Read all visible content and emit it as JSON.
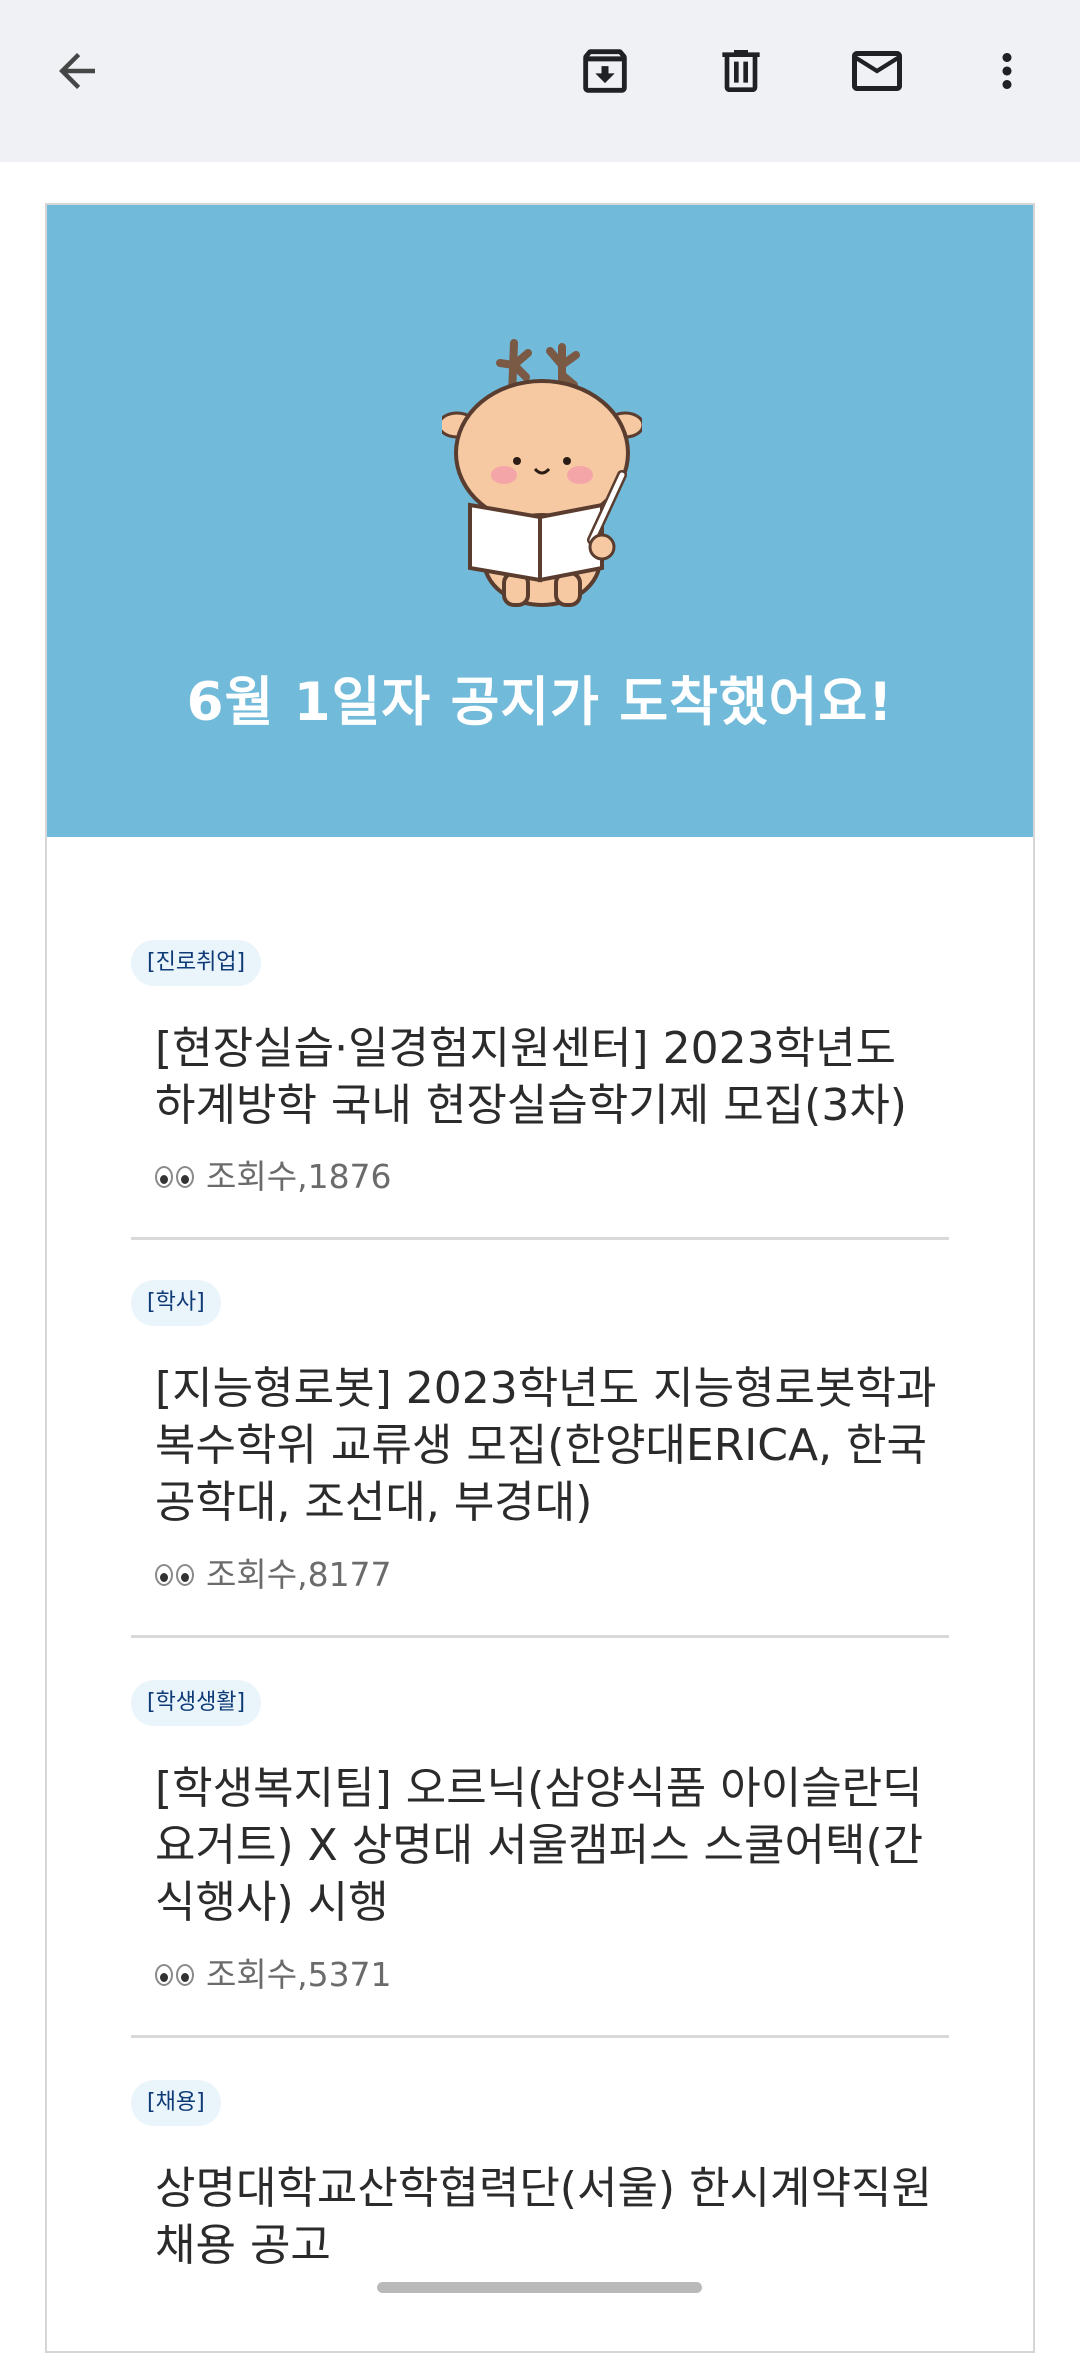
{
  "toolbar": {
    "back_icon": "arrow-left-icon",
    "archive_icon": "archive-icon",
    "delete_icon": "trash-icon",
    "mark_unread_icon": "mail-icon",
    "more_icon": "more-vert-icon"
  },
  "email": {
    "hero_title": "6월 1일자 공지가 도착했어요!",
    "hero_color": "#71bad9",
    "notices": [
      {
        "tag": "[진로취업]",
        "title": "[현장실습·일경험지원센터] 2023학년도 하계방학 국내 현장실습학기제 모집(3차)",
        "views_label": "조회수,1876"
      },
      {
        "tag": "[학사]",
        "title": "[지능형로봇] 2023학년도 지능형로봇학과 복수학위 교류생 모집(한양대ERICA, 한국공학대, 조선대, 부경대)",
        "views_label": "조회수,8177"
      },
      {
        "tag": "[학생생활]",
        "title": "[학생복지팀] 오르닉(삼양식품 아이슬란딕 요거트) X 상명대 서울캠퍼스 스쿨어택(간식행사) 시행",
        "views_label": "조회수,5371"
      },
      {
        "tag": "[채용]",
        "title": "상명대학교산학협력단(서울) 한시계약직원 채용 공고",
        "views_label": ""
      }
    ]
  }
}
